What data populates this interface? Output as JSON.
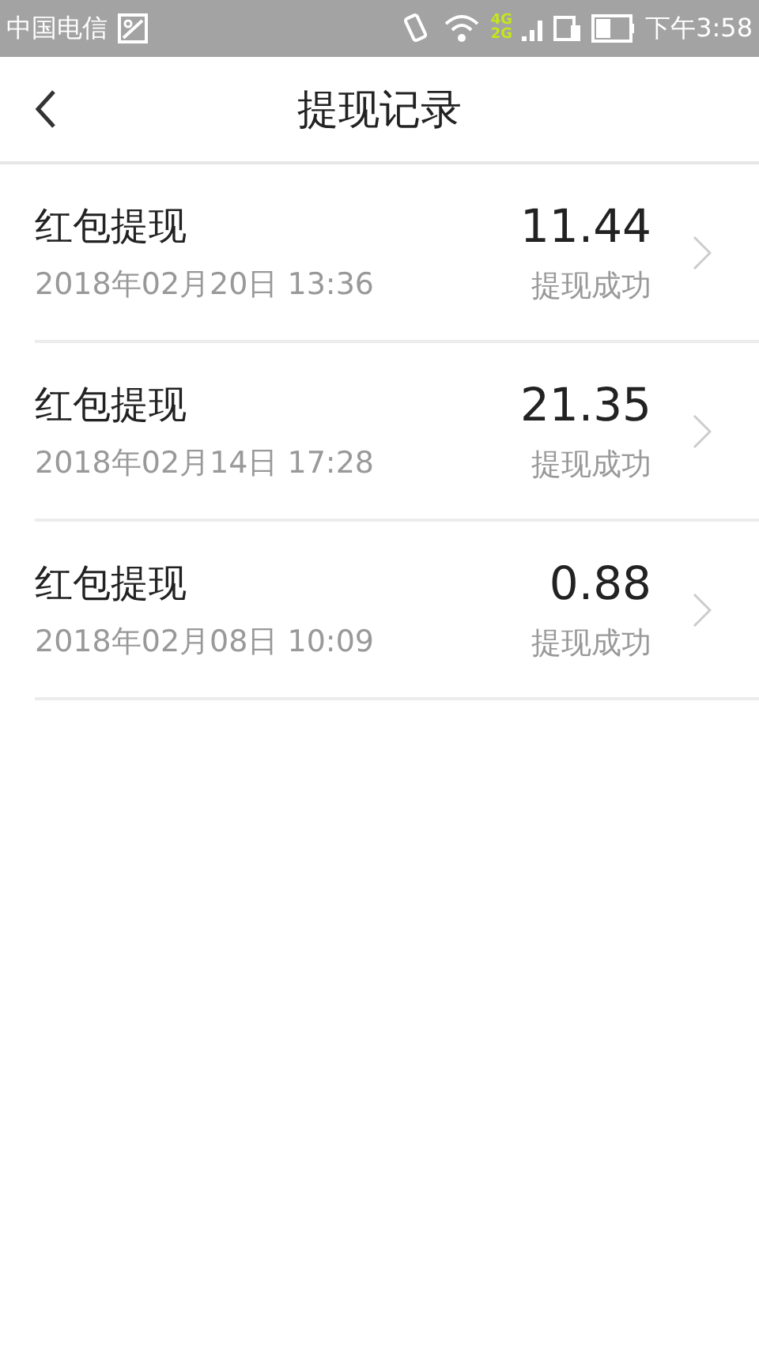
{
  "status_bar": {
    "carrier": "中国电信",
    "network_top": "4G",
    "network_bottom": "2G",
    "time": "下午3:58"
  },
  "header": {
    "title": "提现记录"
  },
  "records": [
    {
      "title": "红包提现",
      "datetime": "2018年02月20日 13:36",
      "amount": "11.44",
      "status": "提现成功"
    },
    {
      "title": "红包提现",
      "datetime": "2018年02月14日 17:28",
      "amount": "21.35",
      "status": "提现成功"
    },
    {
      "title": "红包提现",
      "datetime": "2018年02月08日 10:09",
      "amount": "0.88",
      "status": "提现成功"
    }
  ]
}
